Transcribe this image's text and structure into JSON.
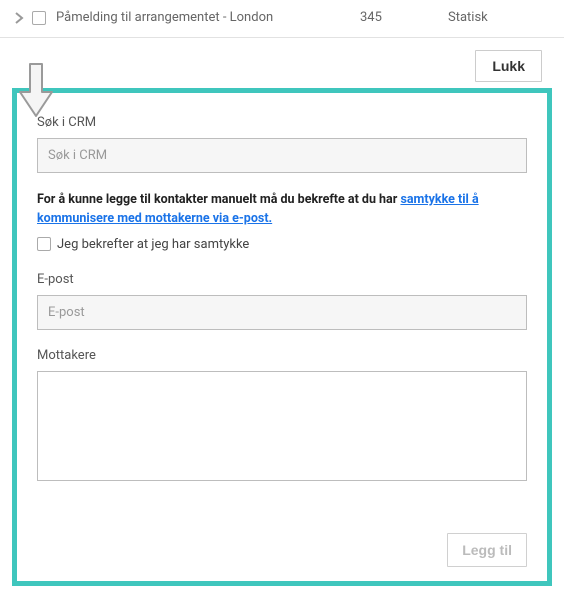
{
  "top_row": {
    "title": "Påmelding til arrangementet - London",
    "count": "345",
    "type": "Statisk"
  },
  "close_button": "Lukk",
  "panel": {
    "search_label": "Søk i CRM",
    "search_placeholder": "Søk i CRM",
    "consent_prefix": "For å kunne legge til kontakter manuelt må du bekrefte at du har ",
    "consent_link": "samtykke til å kommunisere med mottakerne via e-post.",
    "confirm_label": "Jeg bekrefter at jeg har samtykke",
    "email_label": "E-post",
    "email_placeholder": "E-post",
    "recipients_label": "Mottakere",
    "add_button": "Legg til"
  }
}
